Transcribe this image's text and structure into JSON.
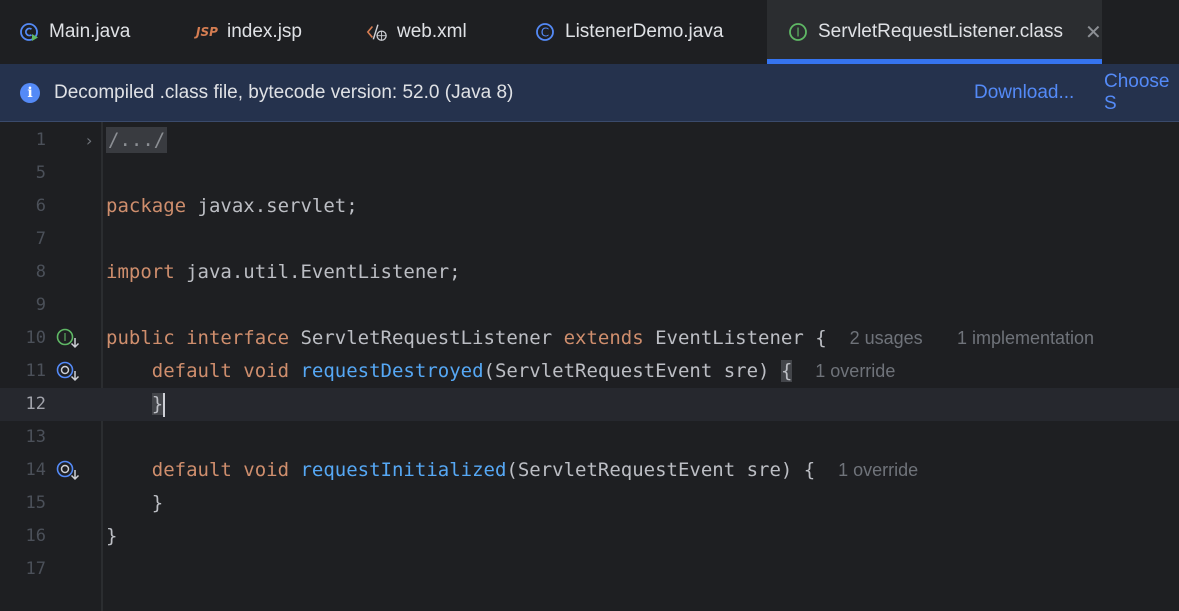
{
  "tabs": [
    {
      "label": "Main.java",
      "icon": "java-class-run-icon"
    },
    {
      "label": "index.jsp",
      "icon": "jsp-icon"
    },
    {
      "label": "web.xml",
      "icon": "xml-web-icon"
    },
    {
      "label": "ListenerDemo.java",
      "icon": "java-class-icon"
    },
    {
      "label": "ServletRequestListener.class",
      "icon": "interface-icon",
      "active": true
    }
  ],
  "tab_icon_text": {
    "jsp": "JSP",
    "interface": "I",
    "class": "C"
  },
  "close_glyph": "✕",
  "banner": {
    "message": "Decompiled .class file, bytecode version: 52.0 (Java 8)",
    "download": "Download...",
    "choose": "Choose S",
    "info_glyph": "i"
  },
  "editor": {
    "line_numbers": [
      "1",
      "5",
      "6",
      "7",
      "8",
      "9",
      "10",
      "11",
      "12",
      "13",
      "14",
      "15",
      "16",
      "17"
    ],
    "current_line": "12",
    "fold_glyph": "›",
    "folded_text": "/.../",
    "pkg_kw": "package",
    "pkg_name": " javax.servlet;",
    "import_kw": "import",
    "import_name": " java.util.EventListener;",
    "decl_public": "public",
    "decl_interface": " interface",
    "decl_name": " ServletRequestListener",
    "decl_extends": " extends",
    "decl_parent": " EventListener {",
    "hint_usages": "2 usages",
    "hint_impl": "1 implementation",
    "indent": "    ",
    "m1_default": "default",
    "m1_void": " void",
    "m1_name": " requestDestroyed",
    "m1_params": "(ServletRequestEvent sre) ",
    "open_brace": "{",
    "hint_override": "1 override",
    "close_brace": "}",
    "m2_default": "default",
    "m2_void": " void",
    "m2_name": " requestInitialized",
    "m2_params": "(ServletRequestEvent sre) {",
    "hint_override2": "1 override",
    "inner_close": "    }",
    "outer_close": "}"
  },
  "colors": {
    "keyword": "#cf8e6d",
    "method": "#56a8f5",
    "accent": "#3574f0",
    "link": "#548af7"
  }
}
